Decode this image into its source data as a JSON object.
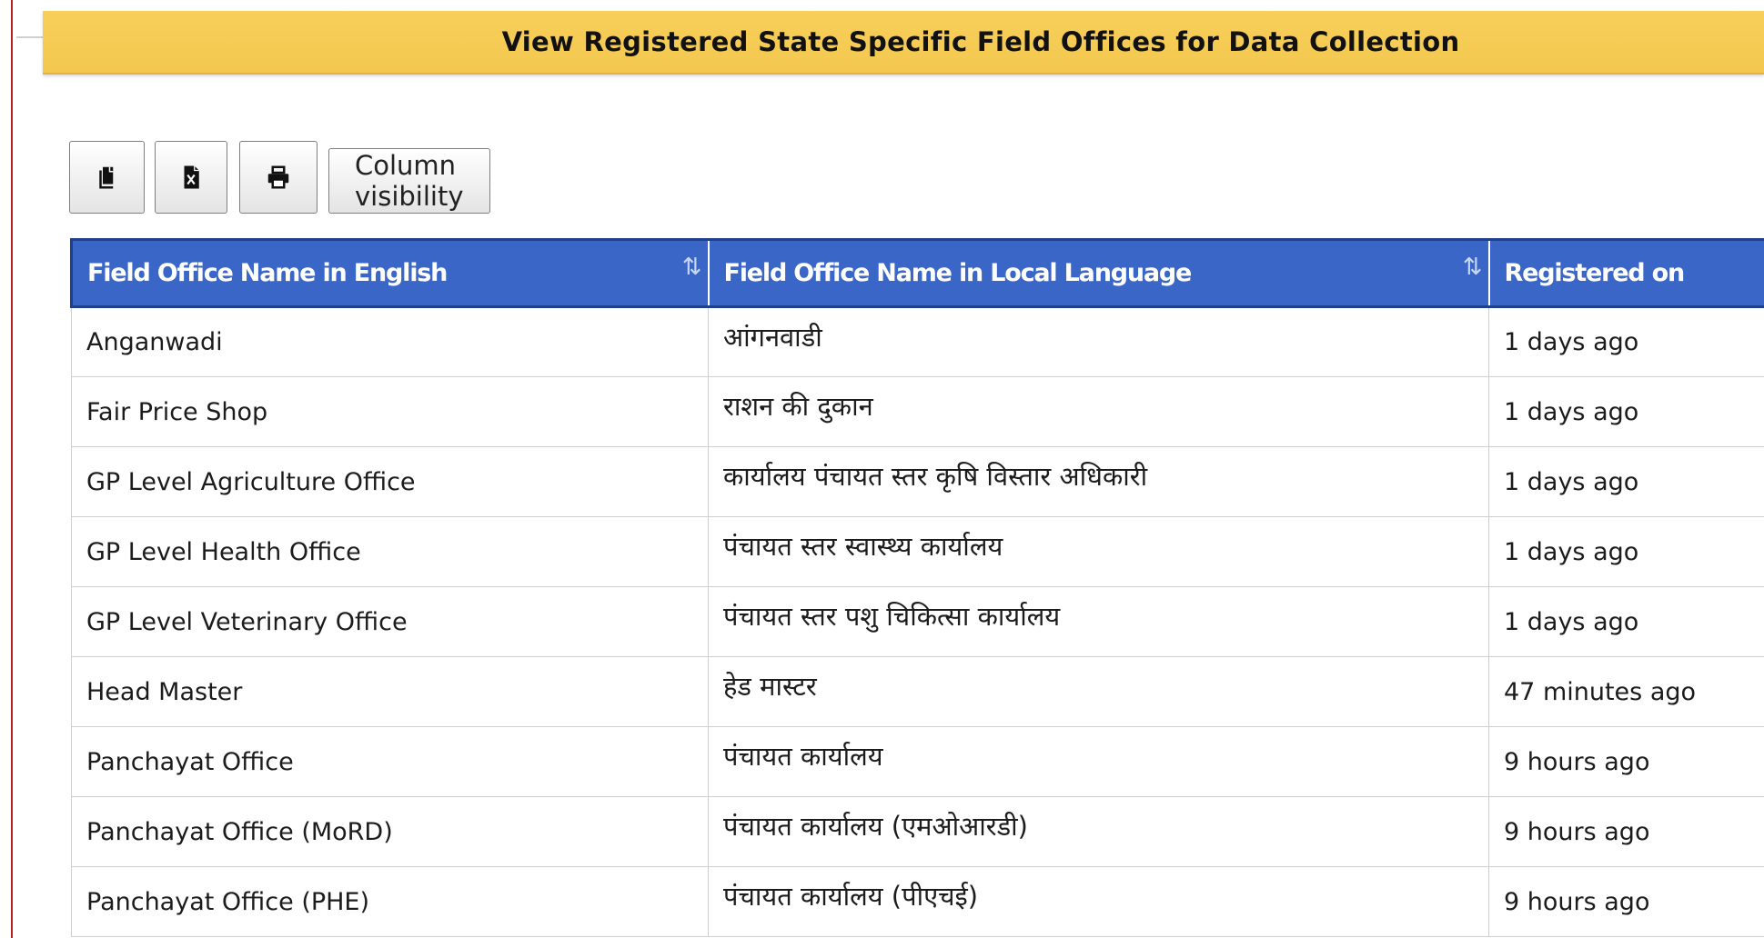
{
  "page": {
    "banner_title": "View Registered State Specific Field Offices for Data Collection"
  },
  "toolbar": {
    "copy_icon": "copy-icon",
    "excel_icon": "excel-icon",
    "print_icon": "print-icon",
    "column_visibility_label": "Column visibility"
  },
  "table": {
    "headers": [
      "Field Office Name in English",
      "Field Office Name in Local Language",
      "Registered on"
    ],
    "sort_glyph": "⇅",
    "rows": [
      {
        "english": "Anganwadi",
        "local": "आंगनवाडी",
        "registered": "1 days ago"
      },
      {
        "english": "Fair Price Shop",
        "local": "राशन की दुकान",
        "registered": "1 days ago"
      },
      {
        "english": "GP Level Agriculture Office",
        "local": "कार्यालय पंचायत स्तर कृषि विस्तार अधिकारी",
        "registered": "1 days ago"
      },
      {
        "english": "GP Level Health Office",
        "local": "पंचायत स्तर स्वास्थ्य कार्यालय",
        "registered": "1 days ago"
      },
      {
        "english": "GP Level Veterinary Office",
        "local": "पंचायत स्तर पशु चिकित्सा कार्यालय",
        "registered": "1 days ago"
      },
      {
        "english": "Head Master",
        "local": "हेड मास्टर",
        "registered": "47 minutes ago"
      },
      {
        "english": "Panchayat Office",
        "local": "पंचायत कार्यालय",
        "registered": "9 hours ago"
      },
      {
        "english": "Panchayat Office (MoRD)",
        "local": "पंचायत कार्यालय (एमओआरडी)",
        "registered": "9 hours ago"
      },
      {
        "english": "Panchayat Office (PHE)",
        "local": "पंचायत कार्यालय (पीएचई)",
        "registered": "9 hours ago"
      }
    ]
  }
}
